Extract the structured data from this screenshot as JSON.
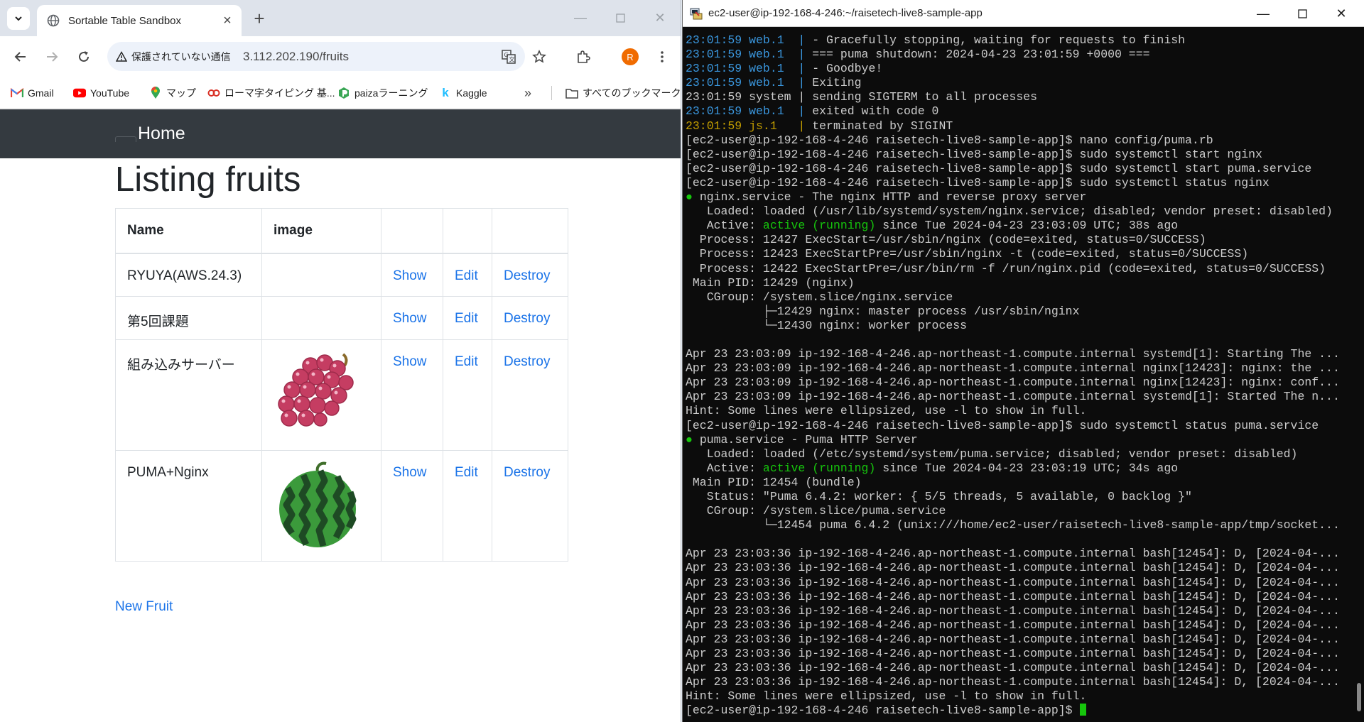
{
  "browser": {
    "tab_title": "Sortable Table Sandbox",
    "security_chip": "保護されていない通信",
    "url": "3.112.202.190/fruits",
    "avatar_letter": "R",
    "bookmarks": [
      "Gmail",
      "YouTube",
      "マップ",
      "ローマ字タイピング 基...",
      "paizaラーニング",
      "Kaggle"
    ],
    "all_bookmarks": "すべてのブックマーク",
    "overflow_icon": "»"
  },
  "page": {
    "brand": "Home",
    "heading": "Listing fruits",
    "columns": [
      "Name",
      "image",
      "",
      "",
      ""
    ],
    "rows": [
      {
        "name": "RYUYA(AWS.24.3)",
        "image": "",
        "show": "Show",
        "edit": "Edit",
        "destroy": "Destroy"
      },
      {
        "name": "第5回課題",
        "image": "",
        "show": "Show",
        "edit": "Edit",
        "destroy": "Destroy"
      },
      {
        "name": "組み込みサーバー",
        "image": "grape-image",
        "show": "Show",
        "edit": "Edit",
        "destroy": "Destroy"
      },
      {
        "name": "PUMA+Nginx",
        "image": "watermelon-image",
        "show": "Show",
        "edit": "Edit",
        "destroy": "Destroy"
      }
    ],
    "new_link": "New Fruit"
  },
  "terminal": {
    "title": "ec2-user@ip-192-168-4-246:~/raisetech-live8-sample-app",
    "lines": [
      [
        [
          "23:01:59 web.1  | ",
          "cy"
        ],
        [
          "- Gracefully stopping, waiting for requests to finish",
          ""
        ]
      ],
      [
        [
          "23:01:59 web.1  | ",
          "cy"
        ],
        [
          "=== puma shutdown: 2024-04-23 23:01:59 +0000 ===",
          ""
        ]
      ],
      [
        [
          "23:01:59 web.1  | ",
          "cy"
        ],
        [
          "- Goodbye!",
          ""
        ]
      ],
      [
        [
          "23:01:59 web.1  | ",
          "cy"
        ],
        [
          "Exiting",
          ""
        ]
      ],
      [
        [
          "23:01:59 system | sending SIGTERM to all processes",
          ""
        ]
      ],
      [
        [
          "23:01:59 web.1  | ",
          "cy"
        ],
        [
          "exited with code 0",
          ""
        ]
      ],
      [
        [
          "23:01:59 js.1   | ",
          "yl"
        ],
        [
          "terminated by SIGINT",
          ""
        ]
      ],
      [
        [
          "[ec2-user@ip-192-168-4-246 raisetech-live8-sample-app]$ nano config/puma.rb",
          ""
        ]
      ],
      [
        [
          "[ec2-user@ip-192-168-4-246 raisetech-live8-sample-app]$ sudo systemctl start nginx",
          ""
        ]
      ],
      [
        [
          "[ec2-user@ip-192-168-4-246 raisetech-live8-sample-app]$ sudo systemctl start puma.service",
          ""
        ]
      ],
      [
        [
          "[ec2-user@ip-192-168-4-246 raisetech-live8-sample-app]$ sudo systemctl status nginx",
          ""
        ]
      ],
      [
        [
          "● ",
          "g"
        ],
        [
          "nginx.service - The nginx HTTP and reverse proxy server",
          ""
        ]
      ],
      [
        [
          "   Loaded: loaded (/usr/lib/systemd/system/nginx.service; disabled; vendor preset: disabled)",
          ""
        ]
      ],
      [
        [
          "   Active: ",
          ""
        ],
        [
          "active (running)",
          "g"
        ],
        [
          " since Tue 2024-04-23 23:03:09 UTC; 38s ago",
          ""
        ]
      ],
      [
        [
          "  Process: 12427 ExecStart=/usr/sbin/nginx (code=exited, status=0/SUCCESS)",
          ""
        ]
      ],
      [
        [
          "  Process: 12423 ExecStartPre=/usr/sbin/nginx -t (code=exited, status=0/SUCCESS)",
          ""
        ]
      ],
      [
        [
          "  Process: 12422 ExecStartPre=/usr/bin/rm -f /run/nginx.pid (code=exited, status=0/SUCCESS)",
          ""
        ]
      ],
      [
        [
          " Main PID: 12429 (nginx)",
          ""
        ]
      ],
      [
        [
          "   CGroup: /system.slice/nginx.service",
          ""
        ]
      ],
      [
        [
          "           ├─12429 nginx: master process /usr/sbin/nginx",
          ""
        ]
      ],
      [
        [
          "           └─12430 nginx: worker process",
          ""
        ]
      ],
      [
        [
          "",
          ""
        ]
      ],
      [
        [
          "Apr 23 23:03:09 ip-192-168-4-246.ap-northeast-1.compute.internal systemd[1]: Starting The ...",
          ""
        ]
      ],
      [
        [
          "Apr 23 23:03:09 ip-192-168-4-246.ap-northeast-1.compute.internal nginx[12423]: nginx: the ...",
          ""
        ]
      ],
      [
        [
          "Apr 23 23:03:09 ip-192-168-4-246.ap-northeast-1.compute.internal nginx[12423]: nginx: conf...",
          ""
        ]
      ],
      [
        [
          "Apr 23 23:03:09 ip-192-168-4-246.ap-northeast-1.compute.internal systemd[1]: Started The n...",
          ""
        ]
      ],
      [
        [
          "Hint: Some lines were ellipsized, use -l to show in full.",
          ""
        ]
      ],
      [
        [
          "[ec2-user@ip-192-168-4-246 raisetech-live8-sample-app]$ sudo systemctl status puma.service",
          ""
        ]
      ],
      [
        [
          "● ",
          "g"
        ],
        [
          "puma.service - Puma HTTP Server",
          ""
        ]
      ],
      [
        [
          "   Loaded: loaded (/etc/systemd/system/puma.service; disabled; vendor preset: disabled)",
          ""
        ]
      ],
      [
        [
          "   Active: ",
          ""
        ],
        [
          "active (running)",
          "g"
        ],
        [
          " since Tue 2024-04-23 23:03:19 UTC; 34s ago",
          ""
        ]
      ],
      [
        [
          " Main PID: 12454 (bundle)",
          ""
        ]
      ],
      [
        [
          "   Status: \"Puma 6.4.2: worker: { 5/5 threads, 5 available, 0 backlog }\"",
          ""
        ]
      ],
      [
        [
          "   CGroup: /system.slice/puma.service",
          ""
        ]
      ],
      [
        [
          "           └─12454 puma 6.4.2 (unix:///home/ec2-user/raisetech-live8-sample-app/tmp/socket...",
          ""
        ]
      ],
      [
        [
          "",
          ""
        ]
      ],
      [
        [
          "Apr 23 23:03:36 ip-192-168-4-246.ap-northeast-1.compute.internal bash[12454]: D, [2024-04-...",
          ""
        ]
      ],
      [
        [
          "Apr 23 23:03:36 ip-192-168-4-246.ap-northeast-1.compute.internal bash[12454]: D, [2024-04-...",
          ""
        ]
      ],
      [
        [
          "Apr 23 23:03:36 ip-192-168-4-246.ap-northeast-1.compute.internal bash[12454]: D, [2024-04-...",
          ""
        ]
      ],
      [
        [
          "Apr 23 23:03:36 ip-192-168-4-246.ap-northeast-1.compute.internal bash[12454]: D, [2024-04-...",
          ""
        ]
      ],
      [
        [
          "Apr 23 23:03:36 ip-192-168-4-246.ap-northeast-1.compute.internal bash[12454]: D, [2024-04-...",
          ""
        ]
      ],
      [
        [
          "Apr 23 23:03:36 ip-192-168-4-246.ap-northeast-1.compute.internal bash[12454]: D, [2024-04-...",
          ""
        ]
      ],
      [
        [
          "Apr 23 23:03:36 ip-192-168-4-246.ap-northeast-1.compute.internal bash[12454]: D, [2024-04-...",
          ""
        ]
      ],
      [
        [
          "Apr 23 23:03:36 ip-192-168-4-246.ap-northeast-1.compute.internal bash[12454]: D, [2024-04-...",
          ""
        ]
      ],
      [
        [
          "Apr 23 23:03:36 ip-192-168-4-246.ap-northeast-1.compute.internal bash[12454]: D, [2024-04-...",
          ""
        ]
      ],
      [
        [
          "Apr 23 23:03:36 ip-192-168-4-246.ap-northeast-1.compute.internal bash[12454]: D, [2024-04-...",
          ""
        ]
      ],
      [
        [
          "Hint: Some lines were ellipsized, use -l to show in full.",
          ""
        ]
      ],
      [
        [
          "[ec2-user@ip-192-168-4-246 raisetech-live8-sample-app]$ ",
          ""
        ]
      ]
    ]
  },
  "colors": {
    "navbar_bg": "#343a40",
    "link": "#1a73e8",
    "term_green": "#16c60c",
    "term_cyan": "#3a96dd",
    "term_yellow": "#c19c00"
  }
}
